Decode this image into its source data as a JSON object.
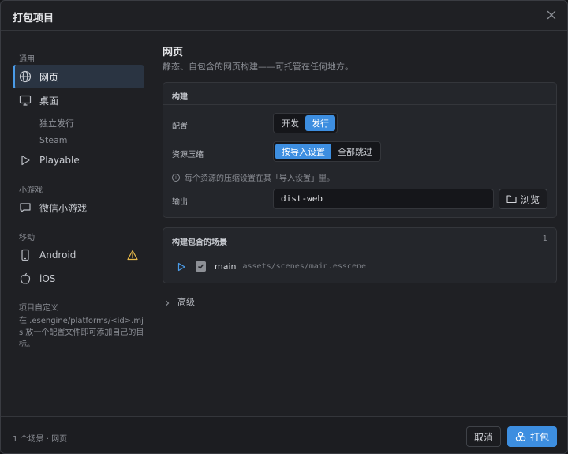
{
  "window": {
    "title": "打包项目"
  },
  "sidebar": {
    "groups": [
      {
        "title": "通用"
      },
      {
        "title": "小游戏"
      },
      {
        "title": "移动"
      },
      {
        "title": "项目自定义"
      }
    ],
    "items": {
      "web": {
        "label": "网页",
        "icon": "globe-icon",
        "active": true
      },
      "desktop": {
        "label": "桌面",
        "icon": "monitor-icon"
      },
      "standalone": {
        "label": "独立发行"
      },
      "steam": {
        "label": "Steam"
      },
      "playable": {
        "label": "Playable",
        "icon": "play-icon"
      },
      "wechat": {
        "label": "微信小游戏",
        "icon": "chat-icon"
      },
      "android": {
        "label": "Android",
        "icon": "phone-icon",
        "badge": "warning-icon"
      },
      "ios": {
        "label": "iOS",
        "icon": "apple-icon"
      }
    },
    "custom_note": "在 .esengine/platforms/<id>.mjs 放一个配置文件即可添加自己的目标。"
  },
  "main": {
    "heading": "网页",
    "subheading": "静态、自包含的网页构建——可托管在任何地方。",
    "build": {
      "title": "构建",
      "config_label": "配置",
      "config_options": [
        "开发",
        "发行"
      ],
      "config_selected": "发行",
      "compress_label": "资源压缩",
      "compress_options": [
        "按导入设置",
        "全部跳过"
      ],
      "compress_selected": "按导入设置",
      "hint": "每个资源的压缩设置在其「导入设置」里。",
      "output_label": "输出",
      "output_value": "dist-web",
      "browse_label": "浏览"
    },
    "scenes": {
      "title": "构建包含的场景",
      "count": "1",
      "items": [
        {
          "name": "main",
          "path": "assets/scenes/main.esscene",
          "checked": true
        }
      ]
    },
    "advanced_label": "高级"
  },
  "footer": {
    "status": "1 个场景 · 网页",
    "cancel_label": "取消",
    "build_label": "打包"
  },
  "colors": {
    "accent": "#3d8ee0",
    "warning": "#e6b84a",
    "background": "#1f2024"
  }
}
